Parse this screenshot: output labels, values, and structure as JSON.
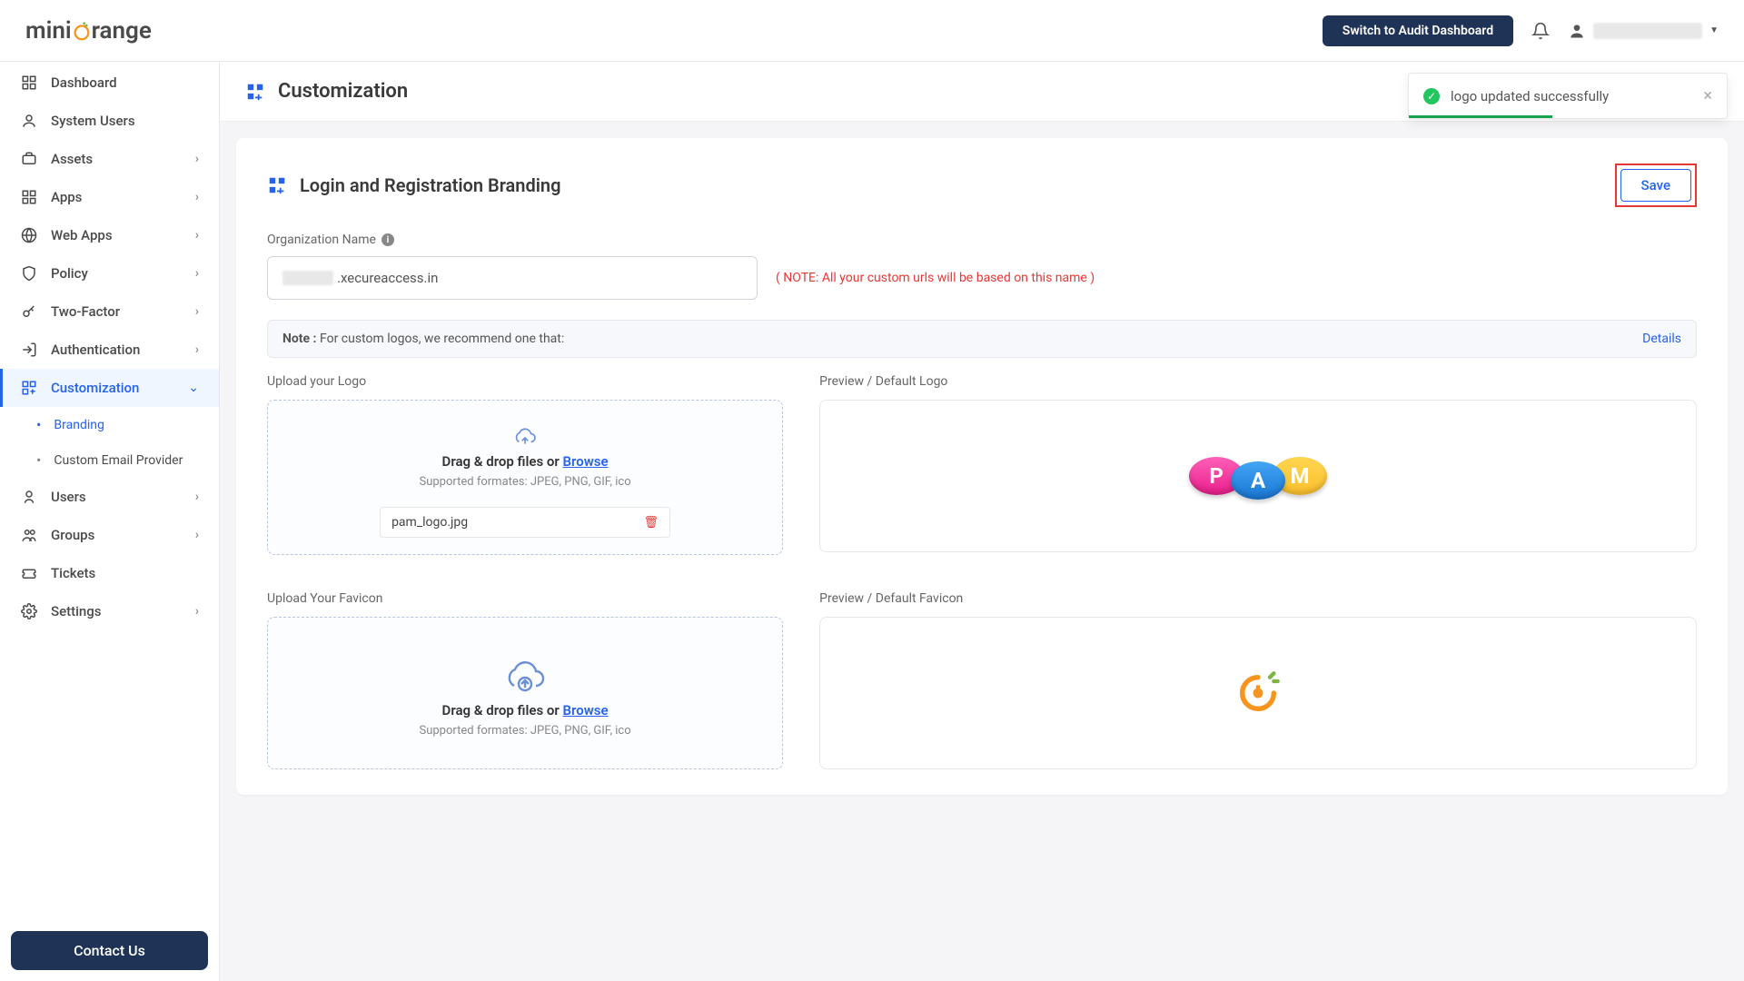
{
  "header": {
    "logo_pre": "mini",
    "logo_post": "range",
    "audit_button": "Switch to Audit Dashboard"
  },
  "sidebar": {
    "dashboard": "Dashboard",
    "system_users": "System Users",
    "assets": "Assets",
    "apps": "Apps",
    "web_apps": "Web Apps",
    "policy": "Policy",
    "two_factor": "Two-Factor",
    "authentication": "Authentication",
    "customization": "Customization",
    "branding": "Branding",
    "custom_email": "Custom Email Provider",
    "users": "Users",
    "groups": "Groups",
    "tickets": "Tickets",
    "settings": "Settings",
    "contact": "Contact Us"
  },
  "page": {
    "title": "Customization",
    "section_title": "Login and Registration Branding",
    "save": "Save",
    "org_label": "Organization Name",
    "org_suffix": ".xecureaccess.in",
    "org_note": "( NOTE: All your custom urls will be based on this name )",
    "logo_note_prefix": "Note : ",
    "logo_note": "For custom logos, we recommend one that:",
    "details": "Details",
    "upload_logo_label": "Upload your Logo",
    "preview_logo_label": "Preview / Default Logo",
    "upload_favicon_label": "Upload Your Favicon",
    "preview_favicon_label": "Preview / Default Favicon",
    "dz_title_prefix": "Drag & drop files or ",
    "dz_browse": "Browse",
    "dz_sub": "Supported formates: JPEG, PNG, GIF, ico",
    "uploaded_file": "pam_logo.jpg"
  },
  "toast": {
    "message": "logo updated successfully"
  }
}
